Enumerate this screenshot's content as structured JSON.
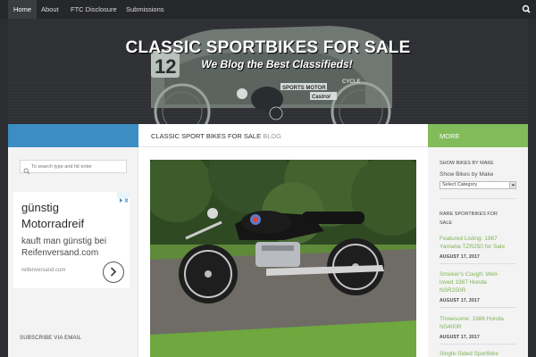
{
  "nav": {
    "items": [
      "Home",
      "About",
      "FTC Disclosure",
      "Submissions"
    ],
    "search_icon": "search-icon"
  },
  "header": {
    "title": "CLASSIC SPORTBIKES FOR SALE",
    "tagline": "We Blog the Best Classifieds!"
  },
  "content_header": {
    "crumb": "CLASSIC SPORT BIKES FOR SALE",
    "crumb_sub": "BLOG"
  },
  "right_header": {
    "label": "MORE"
  },
  "left_sidebar": {
    "search_placeholder": "To search type and hit enter",
    "ad": {
      "headline_1": "günstig",
      "headline_2": "Motorradreif",
      "text_1": "kauft man günstig bei",
      "text_2": "Reifenversand.com",
      "domain": "reifenversand.com",
      "arrow_icon": "chevron-right-icon"
    },
    "subscribe_title": "SUBSCRIBE VIA EMAIL"
  },
  "right_sidebar": {
    "by_make_title": "SHOW BIKES BY MAKE",
    "by_make_label": "Show Bikes by Make",
    "select_value": "Select Category",
    "rare_title_1": "RARE SPORTBIKES FOR",
    "rare_title_2": "SALE",
    "posts": [
      {
        "lines": [
          "Featured Listing: 1987",
          "Yamaha TZR250 for Sale"
        ],
        "date": "AUGUST 17, 2017"
      },
      {
        "lines": [
          "Smoker's Cough: Well-",
          "loved 1987 Honda",
          "NSR250R"
        ],
        "date": "AUGUST 17, 2017"
      },
      {
        "lines": [
          "Threesome: 1986 Honda",
          "NS400R"
        ],
        "date": "AUGUST 17, 2017"
      },
      {
        "lines": [
          "Single-Sided Sportbike"
        ],
        "date": ""
      }
    ]
  },
  "colors": {
    "nav_bg": "#26272b",
    "blue_header": "#3b8dc4",
    "green_header": "#82bb5a",
    "link_green": "#7fb356"
  }
}
